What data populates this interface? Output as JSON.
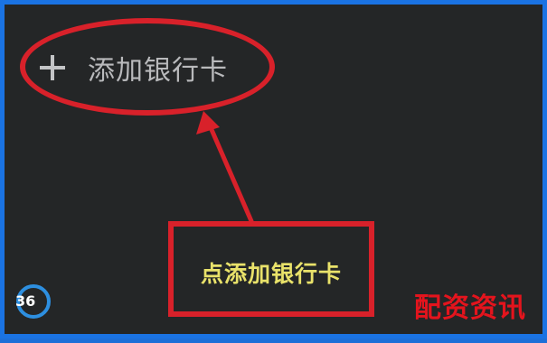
{
  "add_card": {
    "icon": "plus-icon",
    "label": "添加银行卡"
  },
  "callout": {
    "text": "点添加银行卡"
  },
  "logo": {
    "text": "36"
  },
  "watermark": {
    "text": "配资资讯"
  },
  "colors": {
    "frame": "#1a73e3",
    "background": "#242627",
    "annotation": "#d8212a",
    "callout_text": "#e9e26a",
    "watermark": "#e4141d"
  }
}
